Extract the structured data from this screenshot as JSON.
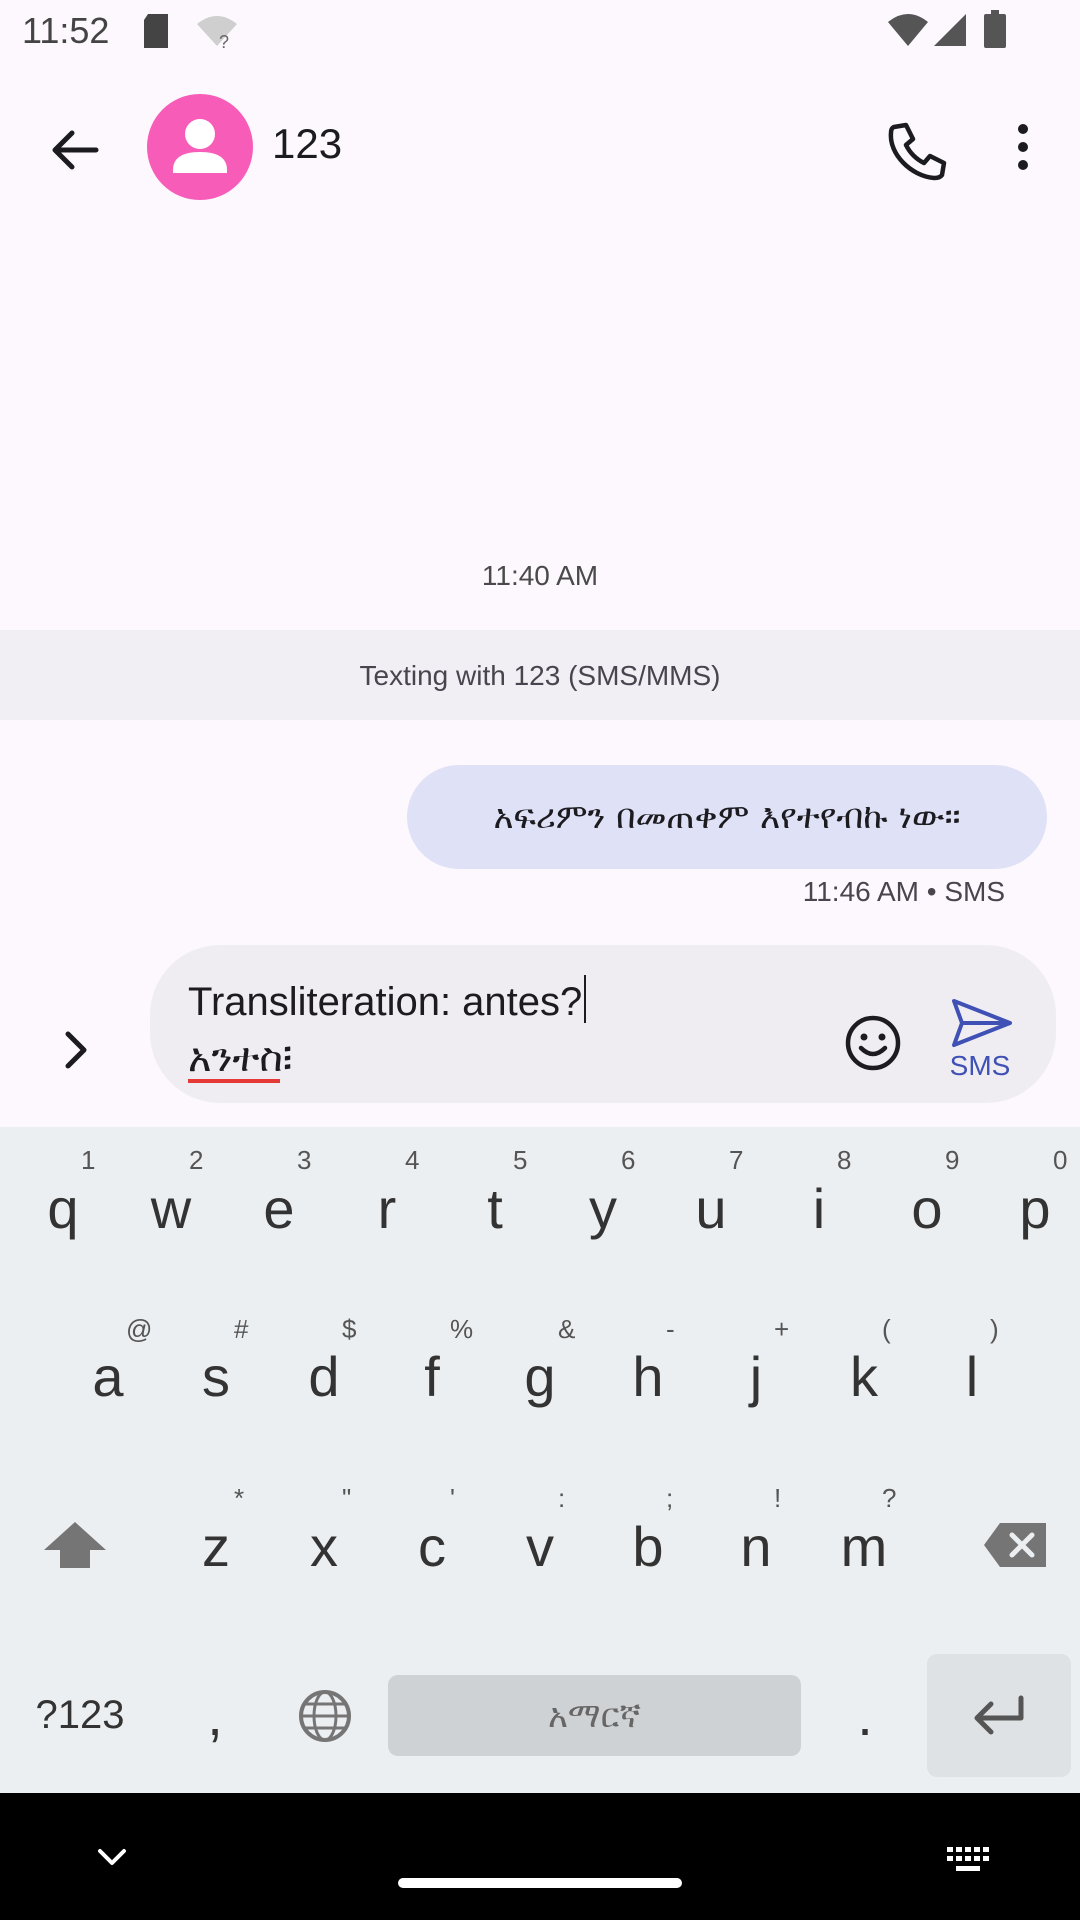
{
  "status_bar": {
    "time": "11:52",
    "icons": [
      "sd-card-icon",
      "wifi-question-icon",
      "wifi-icon",
      "signal-icon",
      "battery-icon"
    ]
  },
  "app_bar": {
    "contact_name": "123",
    "icons": [
      "back-arrow-icon",
      "person-icon",
      "phone-icon",
      "more-vert-icon"
    ],
    "avatar_color": "#f85cb9"
  },
  "conversation": {
    "date_stamp": "11:40 AM",
    "texting_banner": "Texting with 123 (SMS/MMS)",
    "messages": [
      {
        "text": "አፍሪምን በመጠቀም እየተየብኩ ነው።",
        "meta": "11:46 AM • SMS",
        "direction": "outgoing"
      }
    ],
    "bubble_color": "#dfe1f7"
  },
  "composer": {
    "line1": "Transliteration: antes?",
    "line2": "አንተስ፧",
    "send_label": "SMS",
    "icons": [
      "chevron-right-icon",
      "emoji-icon",
      "send-icon"
    ],
    "accent": "#3f51b5"
  },
  "keyboard": {
    "row1": [
      {
        "key": "q",
        "hint": "1"
      },
      {
        "key": "w",
        "hint": "2"
      },
      {
        "key": "e",
        "hint": "3"
      },
      {
        "key": "r",
        "hint": "4"
      },
      {
        "key": "t",
        "hint": "5"
      },
      {
        "key": "y",
        "hint": "6"
      },
      {
        "key": "u",
        "hint": "7"
      },
      {
        "key": "i",
        "hint": "8"
      },
      {
        "key": "o",
        "hint": "9"
      },
      {
        "key": "p",
        "hint": "0"
      }
    ],
    "row2": [
      {
        "key": "a",
        "hint": "@"
      },
      {
        "key": "s",
        "hint": "#"
      },
      {
        "key": "d",
        "hint": "$"
      },
      {
        "key": "f",
        "hint": "%"
      },
      {
        "key": "g",
        "hint": "&"
      },
      {
        "key": "h",
        "hint": "-"
      },
      {
        "key": "j",
        "hint": "+"
      },
      {
        "key": "k",
        "hint": "("
      },
      {
        "key": "l",
        "hint": ")"
      }
    ],
    "row3": [
      {
        "key": "z",
        "hint": "*"
      },
      {
        "key": "x",
        "hint": "\""
      },
      {
        "key": "c",
        "hint": "'"
      },
      {
        "key": "v",
        "hint": ":"
      },
      {
        "key": "b",
        "hint": ";"
      },
      {
        "key": "n",
        "hint": "!"
      },
      {
        "key": "m",
        "hint": "?"
      }
    ],
    "symbols_label": "?123",
    "comma": ",",
    "space_label": "አማርኛ",
    "period": ".",
    "icons": [
      "shift-icon",
      "backspace-icon",
      "globe-icon",
      "enter-icon"
    ]
  },
  "nav_bar": {
    "icons": [
      "chevron-down-icon",
      "keyboard-icon"
    ]
  }
}
